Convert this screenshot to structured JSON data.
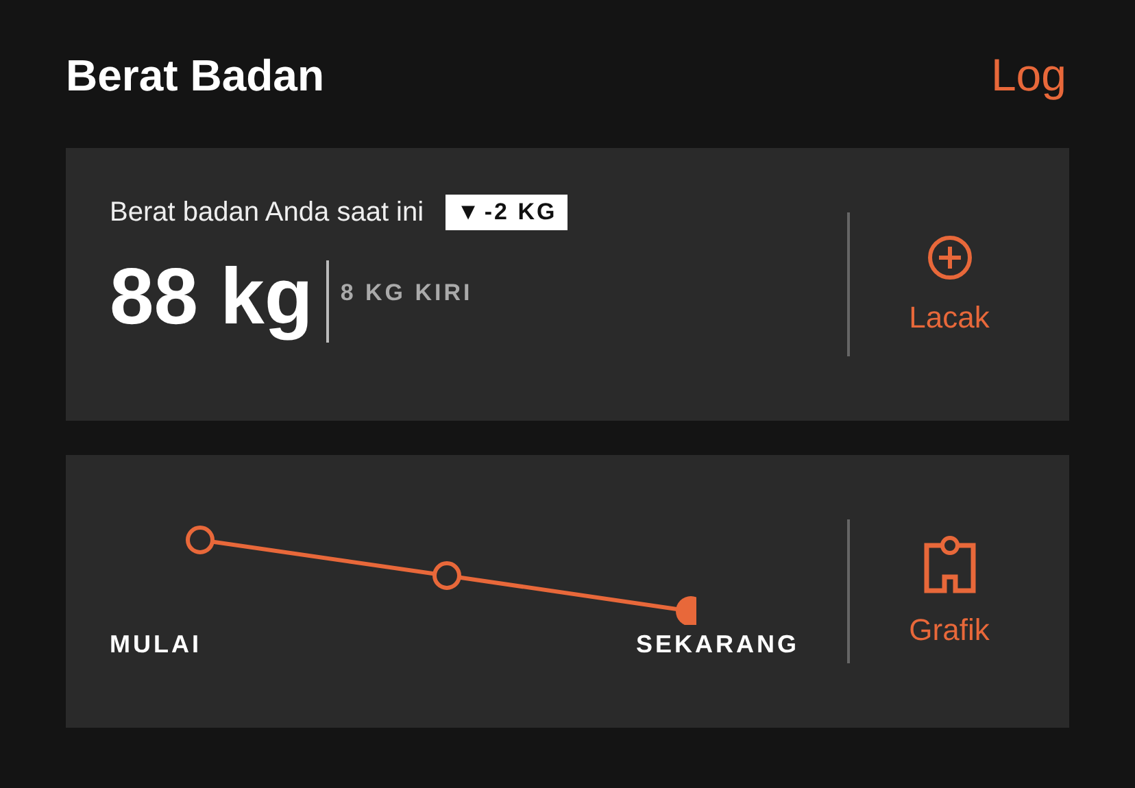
{
  "header": {
    "title": "Berat Badan",
    "action": "Log"
  },
  "current": {
    "label": "Berat badan Anda saat ini",
    "change_arrow": "▼",
    "change": "-2 KG",
    "weight": "88 kg",
    "remaining": "8 KG KIRI",
    "action": "Lacak"
  },
  "progress": {
    "start_label": "MULAI",
    "end_label": "SEKARANG",
    "action": "Grafik"
  }
}
